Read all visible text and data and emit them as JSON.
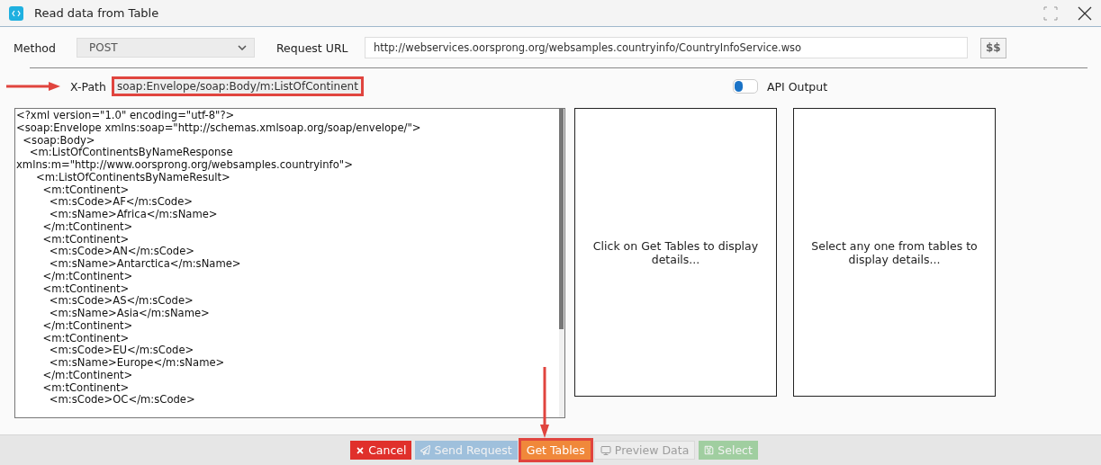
{
  "window": {
    "title": "Read data from Table"
  },
  "method": {
    "label": "Method",
    "value": "POST"
  },
  "request_url": {
    "label": "Request URL",
    "value": "http://webservices.oorsprong.org/websamples.countryinfo/CountryInfoService.wso"
  },
  "dollar_button": "$$",
  "xpath": {
    "label": "X-Path",
    "value": "soap:Envelope/soap:Body/m:ListOfContinent",
    "highlighted": true,
    "arrow": true
  },
  "api_output": {
    "label": "API Output",
    "on": false
  },
  "response_lines": [
    "<?xml version=\"1.0\" encoding=\"utf-8\"?>",
    "<soap:Envelope xmlns:soap=\"http://schemas.xmlsoap.org/soap/envelope/\">",
    "  <soap:Body>",
    "    <m:ListOfContinentsByNameResponse",
    "xmlns:m=\"http://www.oorsprong.org/websamples.countryinfo\">",
    "      <m:ListOfContinentsByNameResult>",
    "        <m:tContinent>",
    "          <m:sCode>AF</m:sCode>",
    "          <m:sName>Africa</m:sName>",
    "        </m:tContinent>",
    "        <m:tContinent>",
    "          <m:sCode>AN</m:sCode>",
    "          <m:sName>Antarctica</m:sName>",
    "        </m:tContinent>",
    "        <m:tContinent>",
    "          <m:sCode>AS</m:sCode>",
    "          <m:sName>Asia</m:sName>",
    "        </m:tContinent>",
    "        <m:tContinent>",
    "          <m:sCode>EU</m:sCode>",
    "          <m:sName>Europe</m:sName>",
    "        </m:tContinent>",
    "        <m:tContinent>",
    "          <m:sCode>OC</m:sCode>"
  ],
  "panels": [
    "Click on Get Tables to display details...",
    "Select any one from tables to display details..."
  ],
  "buttons": [
    {
      "kind": "cancel",
      "label": "Cancel",
      "disabled": false,
      "highlighted": false,
      "arrow": false
    },
    {
      "kind": "send",
      "label": "Send Request",
      "disabled": true,
      "highlighted": false,
      "arrow": false
    },
    {
      "kind": "tables",
      "label": "Get Tables",
      "disabled": false,
      "highlighted": true,
      "arrow": true
    },
    {
      "kind": "preview",
      "label": "Preview Data",
      "disabled": true,
      "highlighted": false,
      "arrow": false
    },
    {
      "kind": "select",
      "label": "Select",
      "disabled": true,
      "highlighted": false,
      "arrow": false
    }
  ]
}
